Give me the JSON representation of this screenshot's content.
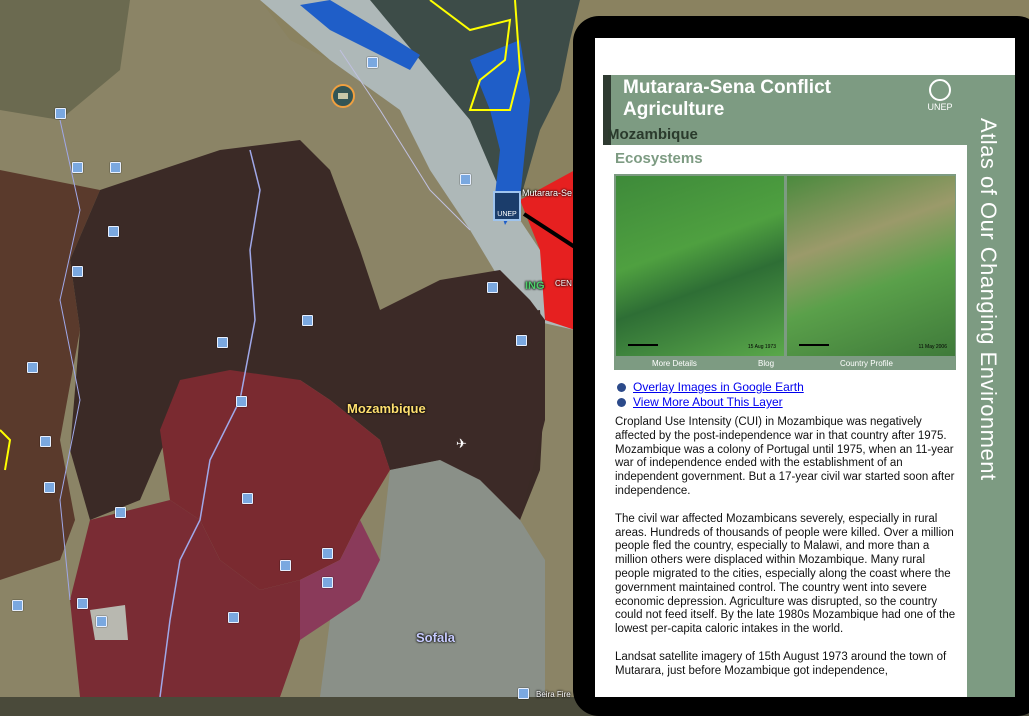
{
  "map": {
    "labels": {
      "country": "Mozambique",
      "city": "Sofala",
      "placemark_town": "Mutarara-Se",
      "placemark_town2": "Beira Fire",
      "red_label": "CEN",
      "green_label": "ING"
    },
    "colors": {
      "terrain": "#8a8260",
      "dark_region": "#3b2a26",
      "brown_region": "#5a3a2c",
      "red_region": "#7a2a30",
      "water": "#1f5ec8",
      "pale": "#b0b6b0"
    }
  },
  "balloon": {
    "title_line1": "Mutarara-Sena Conflict",
    "title_line2": "Agriculture",
    "country": "Mozambique",
    "logo": "UNEP",
    "sidebar_title": "Atlas of Our Changing Environment",
    "section": "Ecosystems",
    "image_left_date": "15 Aug 1973",
    "image_right_date": "11 May 2006",
    "image_links": [
      "More Details",
      "Blog",
      "Country Profile"
    ],
    "links": [
      "Overlay Images in Google Earth",
      "View More About This Layer"
    ],
    "paragraphs": [
      "Cropland Use Intensity (CUI) in Mozambique was negatively affected by the post-independence war in that country after 1975. Mozambique was a colony of Portugal until 1975, when an 11-year war of independence ended with the establishment of an independent government. But a 17-year civil war started soon after independence.",
      "The civil war affected Mozambicans severely, especially in rural areas. Hundreds of thousands of people were killed. Over a million people fled the country, especially to Malawi, and more than a million others were displaced within Mozambique. Many rural people migrated to the cities, especially along the coast where the government maintained control. The country went into severe economic depression. Agriculture was disrupted, so the country could not feed itself. By the late 1980s Mozambique had one of the lowest per-capita caloric intakes in the world.",
      "Landsat satellite imagery of 15th August 1973 around the town of Mutarara, just before Mozambique got independence,"
    ]
  }
}
